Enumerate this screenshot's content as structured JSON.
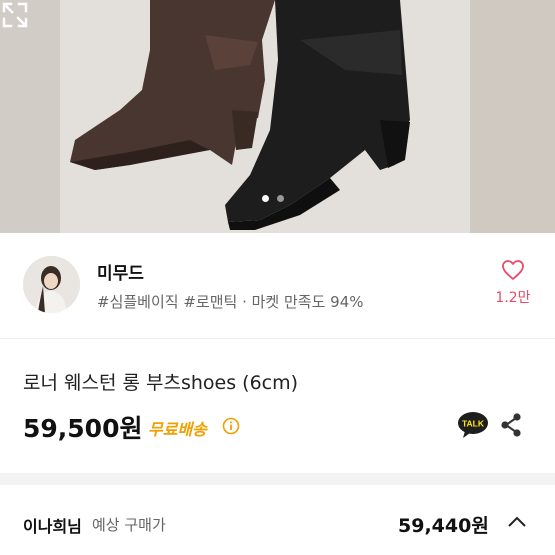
{
  "hero": {
    "image_desc": "boots",
    "slide_total": 2,
    "slide_active": 1
  },
  "seller": {
    "name": "미무드",
    "tags": "#심플베이직 #로맨틱 · 마켓 만족도 94%",
    "like_count": "1.2만"
  },
  "product": {
    "title": "로너 웨스턴 롱 부츠shoes (6cm)",
    "price": "59,500원",
    "free_shipping": "무료배송"
  },
  "buyer": {
    "name": "이나희님",
    "label": "예상 구매가",
    "price": "59,440원"
  },
  "colors": {
    "like_pink": "#e94b6a",
    "free_ship_orange": "#f0a000",
    "talk_yellow": "#ffe812"
  }
}
